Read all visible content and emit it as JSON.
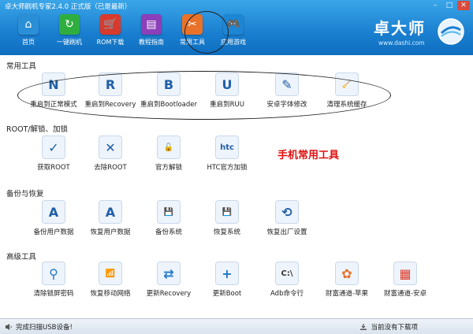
{
  "window": {
    "title": "卓大师刷机专家2.4.0 正式版（已是最新）",
    "controls": [
      "–",
      "□",
      "✕"
    ]
  },
  "nav": {
    "items": [
      {
        "label": "首页",
        "icon": "home-icon",
        "color": "#2a8fd6",
        "glyph": "⌂"
      },
      {
        "label": "一键刷机",
        "icon": "refresh-icon",
        "color": "#2fae3f",
        "glyph": "↻"
      },
      {
        "label": "ROM下载",
        "icon": "cart-icon",
        "color": "#d93a2b",
        "glyph": "🛒"
      },
      {
        "label": "教程指南",
        "icon": "book-icon",
        "color": "#8b3fb8",
        "glyph": "▤"
      },
      {
        "label": "常用工具",
        "icon": "tools-icon",
        "color": "#e8722a",
        "glyph": "✂"
      },
      {
        "label": "应用游戏",
        "icon": "gamepad-icon",
        "color": "#1d86d4",
        "glyph": "🎮"
      }
    ]
  },
  "brand": {
    "name": "卓大师",
    "url": "www.dashi.com"
  },
  "sections": {
    "common": "常用工具",
    "root": "ROOT/解锁、加锁",
    "backup": "备份与恢复",
    "advanced": "高级工具"
  },
  "tools": {
    "common": [
      {
        "label": "重启到正常模式",
        "icon": "reboot-normal-icon",
        "glyph": "N"
      },
      {
        "label": "重启到Recovery",
        "icon": "reboot-recovery-icon",
        "glyph": "R"
      },
      {
        "label": "重启到Bootloader",
        "icon": "reboot-bootloader-icon",
        "glyph": "B"
      },
      {
        "label": "重启到RUU",
        "icon": "reboot-ruu-icon",
        "glyph": "U"
      },
      {
        "label": "安卓字体修改",
        "icon": "font-edit-icon",
        "glyph": "✎"
      },
      {
        "label": "清理系统缓存",
        "icon": "broom-icon",
        "glyph": "🧹"
      }
    ],
    "root": [
      {
        "label": "获取ROOT",
        "icon": "android-root-icon",
        "glyph": "✓"
      },
      {
        "label": "去除ROOT",
        "icon": "android-unroot-icon",
        "glyph": "✕"
      },
      {
        "label": "官方解锁",
        "icon": "unlock-icon",
        "glyph": "🔓"
      },
      {
        "label": "HTC官方加锁",
        "icon": "htc-lock-icon",
        "glyph": "htc"
      }
    ],
    "backup": [
      {
        "label": "备份用户数据",
        "icon": "backup-user-icon",
        "glyph": "A"
      },
      {
        "label": "恢复用户数据",
        "icon": "restore-user-icon",
        "glyph": "A"
      },
      {
        "label": "备份系统",
        "icon": "backup-system-icon",
        "glyph": "💾"
      },
      {
        "label": "恢复系统",
        "icon": "restore-system-icon",
        "glyph": "💾"
      },
      {
        "label": "恢复出厂设置",
        "icon": "factory-reset-icon",
        "glyph": "⟲"
      }
    ],
    "advanced": [
      {
        "label": "清除锁屏密码",
        "icon": "key-icon",
        "glyph": "⚲"
      },
      {
        "label": "恢复移动网络",
        "icon": "signal-icon",
        "glyph": "📶"
      },
      {
        "label": "更新Recovery",
        "icon": "update-recovery-icon",
        "glyph": "⇄"
      },
      {
        "label": "更新Boot",
        "icon": "update-boot-icon",
        "glyph": "+"
      },
      {
        "label": "Adb命令行",
        "icon": "terminal-icon",
        "glyph": "C:\\"
      },
      {
        "label": "财富通道-苹果",
        "icon": "apple-channel-icon",
        "glyph": "✿"
      },
      {
        "label": "财富通道-安卓",
        "icon": "android-channel-icon",
        "glyph": "▦"
      }
    ]
  },
  "annotation": {
    "text": "手机常用工具",
    "color": "#e01010"
  },
  "status": {
    "left": "完成扫描USB设备!",
    "right": "当前没有下载项"
  }
}
